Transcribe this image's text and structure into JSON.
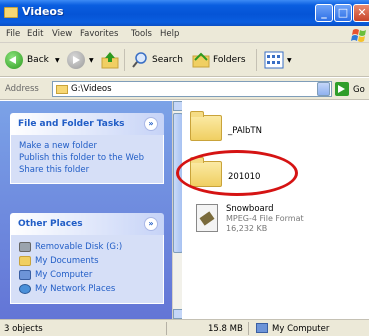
{
  "window": {
    "title": "Videos"
  },
  "menu": [
    "File",
    "Edit",
    "View",
    "Favorites",
    "Tools",
    "Help"
  ],
  "toolbar": {
    "back_label": "Back",
    "search_label": "Search",
    "folders_label": "Folders"
  },
  "address": {
    "label": "Address",
    "value": "G:\\Videos",
    "go_label": "Go"
  },
  "file_tasks": {
    "title": "File and Folder Tasks",
    "items": [
      "Make a new folder",
      "Publish this folder to the Web",
      "Share this folder"
    ]
  },
  "other_places": {
    "title": "Other Places",
    "items": [
      "Removable Disk (G:)",
      "My Documents",
      "My Computer",
      "My Network Places"
    ]
  },
  "items": [
    {
      "name": "_PAlbTN"
    },
    {
      "name": "201010"
    },
    {
      "name": "Snowboard",
      "type": "MPEG-4 File Format",
      "size": "16,232 KB"
    }
  ],
  "status": {
    "count": "3 objects",
    "size": "15.8 MB",
    "location": "My Computer"
  },
  "colors": {
    "titlebar": "#0554d6",
    "task_pane": "#6375d6",
    "link": "#215dc6",
    "highlight_circle": "#d51313"
  }
}
